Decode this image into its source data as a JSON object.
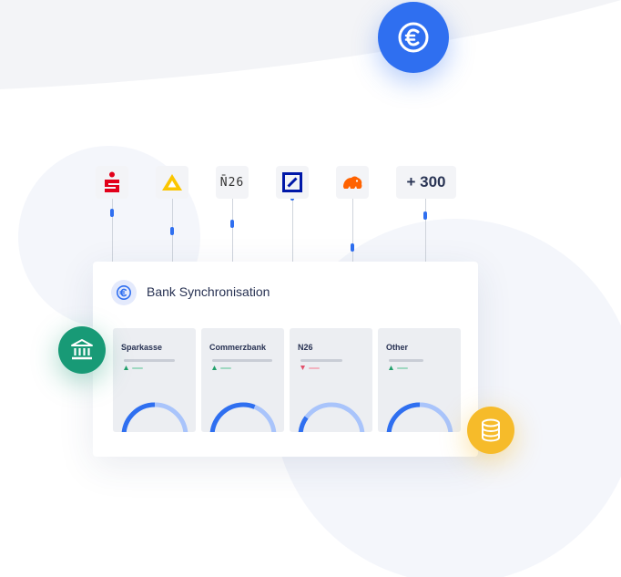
{
  "logos": [
    {
      "name": "Sparkasse",
      "icon": "sparkasse-logo-icon",
      "color": "#e2001a"
    },
    {
      "name": "Commerzbank",
      "icon": "commerzbank-logo-icon",
      "color": "#fbc600"
    },
    {
      "name": "N26",
      "text": "N̄26"
    },
    {
      "name": "Deutsche Bank",
      "icon": "deutsche-bank-logo-icon",
      "color": "#0018a8"
    },
    {
      "name": "ING",
      "icon": "ing-lion-icon",
      "color": "#ff6200"
    },
    {
      "text": "+ 300"
    }
  ],
  "card": {
    "title": "Bank Synchronisation",
    "tiles": [
      {
        "name": "Sparkasse",
        "trend": "up",
        "gauge": 0.5
      },
      {
        "name": "Commerzbank",
        "trend": "up",
        "gauge": 0.62
      },
      {
        "name": "N26",
        "trend": "down",
        "gauge": 0.2
      },
      {
        "name": "Other",
        "trend": "up",
        "gauge": 0.5
      }
    ]
  },
  "colors": {
    "accent": "#2f6ff0",
    "accent_light": "#a9c4fb",
    "green": "#189a76",
    "yellow": "#f6bb2a",
    "red": "#e2506a",
    "up": "#22a06b"
  },
  "icons": [
    "euro-icon",
    "bank-building-icon",
    "coins-stack-icon"
  ]
}
